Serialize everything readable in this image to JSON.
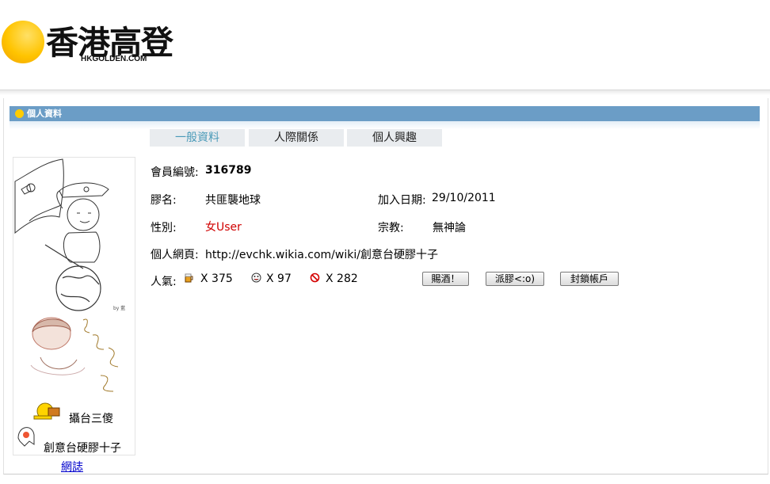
{
  "logo": {
    "chinese": "香港高登",
    "english": "HKGOLDEN.COM",
    "accent": "#ffc400"
  },
  "section": {
    "title": "個人資料",
    "bar_color": "#6b9dc6"
  },
  "tabs": [
    {
      "label": "一般資料",
      "active": true
    },
    {
      "label": "人際關係",
      "active": false
    },
    {
      "label": "個人興趣",
      "active": false
    }
  ],
  "profile": {
    "member_id_label": "會員編號:",
    "member_id": "316789",
    "name_label": "膠名:",
    "name": "共匪襲地球",
    "join_label": "加入日期:",
    "join_date": "29/10/2011",
    "gender_label": "性別:",
    "gender": "女User",
    "religion_label": "宗教:",
    "religion": "無神論",
    "homepage_label": "個人網頁:",
    "homepage": "http://evchk.wikia.com/wiki/創意台硬膠十子",
    "popularity_label": "人氣:",
    "popularity": [
      {
        "icon": "beer-icon",
        "text": "X 375"
      },
      {
        "icon": "smiley-icon",
        "text": "X 97"
      },
      {
        "icon": "ban-icon",
        "text": "X 282"
      }
    ]
  },
  "buttons": {
    "gift_wine": "賜酒！",
    "give_plastic": "派膠<:o)",
    "block": "封鎖帳戶"
  },
  "avatar": {
    "caption1": "攝台三傻",
    "caption2": "創意台硬膠十子"
  },
  "footer": {
    "blog_link": "網誌"
  }
}
